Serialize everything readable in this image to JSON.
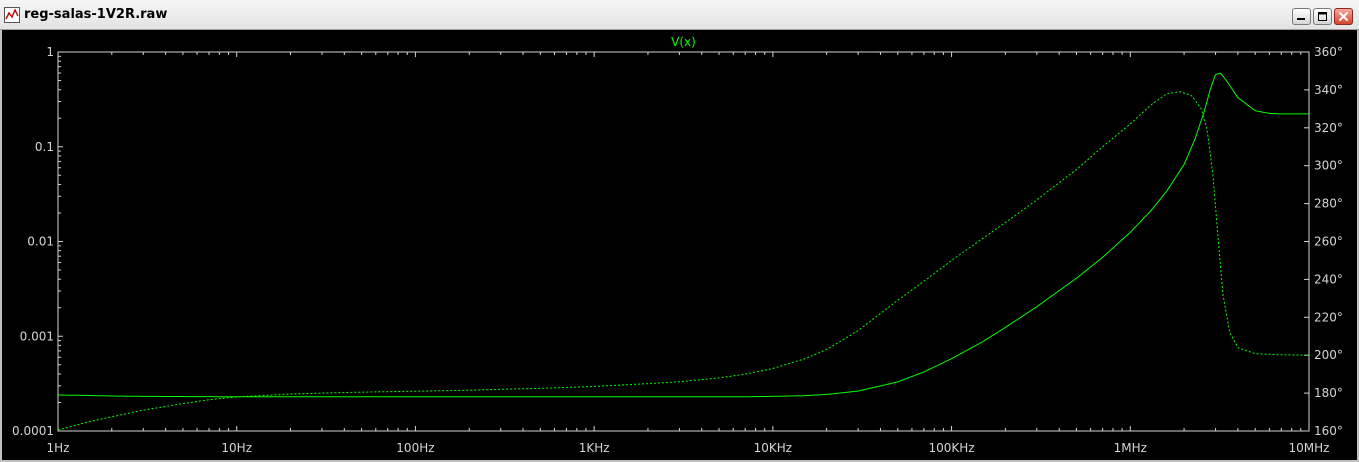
{
  "window": {
    "title": "reg-salas-1V2R.raw",
    "icon": "waveform-icon",
    "buttons": [
      "minimize",
      "maximize",
      "close"
    ]
  },
  "colors": {
    "background": "#000000",
    "axis": "#d4d4d4",
    "trace": "#00ff00"
  },
  "chart_data": {
    "type": "line",
    "title": "V(x)",
    "x_scale": "log",
    "y_scale": "log",
    "xlim": [
      1,
      10000000
    ],
    "ylim": [
      0.0001,
      1
    ],
    "y2lim": [
      160,
      360
    ],
    "grid": false,
    "x_ticks": [
      {
        "value": 1,
        "label": "1Hz"
      },
      {
        "value": 10,
        "label": "10Hz"
      },
      {
        "value": 100,
        "label": "100Hz"
      },
      {
        "value": 1000,
        "label": "1KHz"
      },
      {
        "value": 10000,
        "label": "10KHz"
      },
      {
        "value": 100000,
        "label": "100KHz"
      },
      {
        "value": 1000000,
        "label": "1MHz"
      },
      {
        "value": 10000000,
        "label": "10MHz"
      }
    ],
    "y_ticks": [
      {
        "value": 1,
        "label": "1"
      },
      {
        "value": 0.1,
        "label": "0.1"
      },
      {
        "value": 0.01,
        "label": "0.01"
      },
      {
        "value": 0.001,
        "label": "0.001"
      },
      {
        "value": 0.0001,
        "label": "0.0001"
      }
    ],
    "y2_ticks": [
      {
        "value": 160,
        "label": "160°"
      },
      {
        "value": 180,
        "label": "180°"
      },
      {
        "value": 200,
        "label": "200°"
      },
      {
        "value": 220,
        "label": "220°"
      },
      {
        "value": 240,
        "label": "240°"
      },
      {
        "value": 260,
        "label": "260°"
      },
      {
        "value": 280,
        "label": "280°"
      },
      {
        "value": 300,
        "label": "300°"
      },
      {
        "value": 320,
        "label": "320°"
      },
      {
        "value": 340,
        "label": "340°"
      },
      {
        "value": 360,
        "label": "360°"
      }
    ],
    "series": [
      {
        "axis": "left",
        "style": "solid",
        "x": [
          1,
          1.5,
          2,
          3,
          5,
          10,
          30,
          100,
          300,
          1000,
          3000,
          7000,
          10000,
          15000,
          20000,
          30000,
          50000,
          70000,
          100000,
          150000,
          200000,
          300000,
          500000,
          700000,
          1000000,
          1300000,
          1600000,
          2000000,
          2300000,
          2600000,
          2800000,
          3000000,
          3200000,
          3500000,
          4000000,
          5000000,
          6000000,
          7000000,
          8000000,
          10000000
        ],
        "y": [
          0.00024,
          0.000237,
          0.000234,
          0.000232,
          0.000231,
          0.00023,
          0.00023,
          0.00023,
          0.00023,
          0.00023,
          0.00023,
          0.00023,
          0.000232,
          0.000236,
          0.000243,
          0.000264,
          0.00033,
          0.00042,
          0.00058,
          0.00088,
          0.00124,
          0.00205,
          0.0041,
          0.0068,
          0.0125,
          0.021,
          0.034,
          0.065,
          0.12,
          0.24,
          0.4,
          0.58,
          0.6,
          0.48,
          0.33,
          0.24,
          0.225,
          0.222,
          0.222,
          0.222
        ]
      },
      {
        "axis": "right",
        "style": "dashed",
        "x": [
          1,
          1.5,
          2,
          3,
          5,
          7,
          10,
          20,
          30,
          50,
          100,
          200,
          300,
          500,
          1000,
          2000,
          3000,
          5000,
          7000,
          10000,
          15000,
          20000,
          30000,
          50000,
          70000,
          100000,
          200000,
          300000,
          500000,
          700000,
          1000000,
          1300000,
          1600000,
          1900000,
          2200000,
          2500000,
          2700000,
          2900000,
          3100000,
          3300000,
          3600000,
          4000000,
          5000000,
          7000000,
          10000000
        ],
        "y": [
          160.5,
          165,
          167.5,
          171,
          174.5,
          176.5,
          178,
          179.5,
          180,
          180.5,
          181,
          181.5,
          182,
          182.5,
          183.5,
          185,
          186,
          188,
          190,
          193,
          198,
          203,
          213,
          229,
          239,
          250,
          270,
          282,
          298,
          310,
          322,
          332,
          338,
          339,
          337,
          330,
          318,
          295,
          262,
          232,
          212,
          204,
          200.8,
          200.2,
          200
        ]
      }
    ]
  }
}
